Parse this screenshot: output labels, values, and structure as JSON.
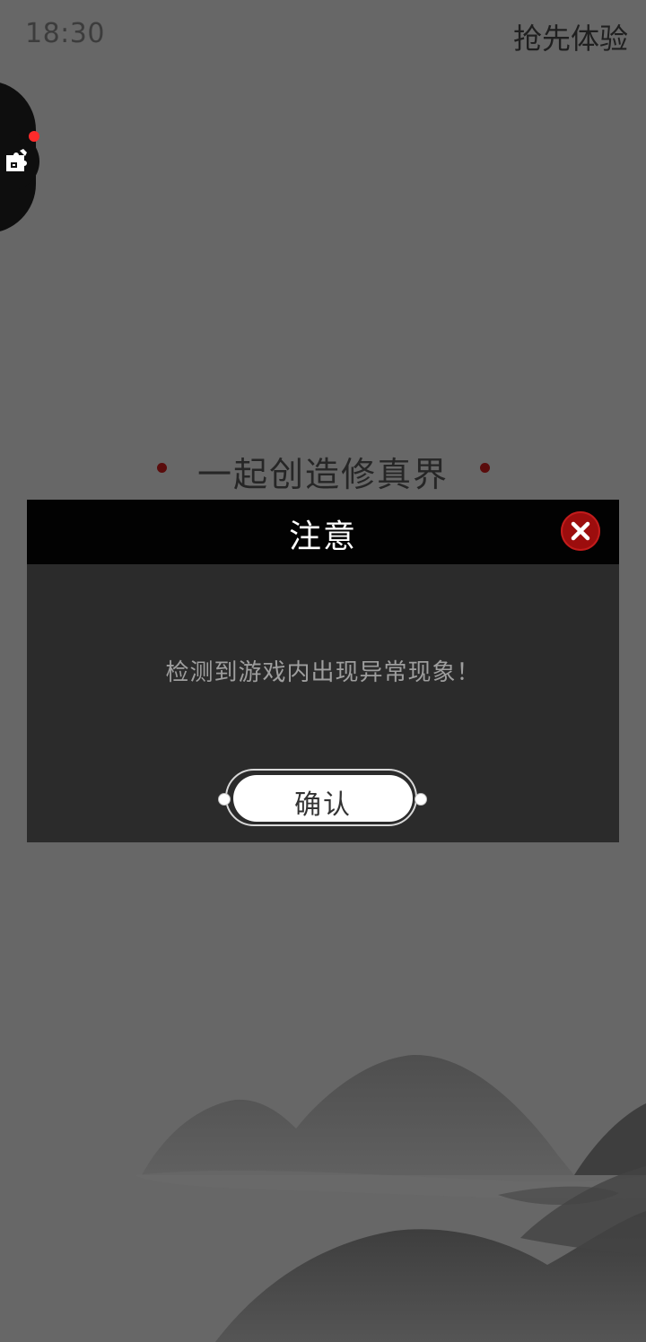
{
  "status_bar": {
    "time": "18:30"
  },
  "header": {
    "early_access_label": "抢先体验"
  },
  "floating_button": {
    "icon": "puzzle-icon",
    "has_notification": true
  },
  "tagline": "一起创造修真界",
  "dialog": {
    "title": "注意",
    "message": "检测到游戏内出现异常现象！",
    "confirm_label": "确认",
    "close_icon": "close-icon"
  },
  "colors": {
    "background": "#676767",
    "dialog_body": "#2b2b2b",
    "dialog_header": "#020202",
    "close_button": "#9c0d0d",
    "notification_dot": "#ff2b2b",
    "tagline_dot": "#5a0c0c"
  }
}
